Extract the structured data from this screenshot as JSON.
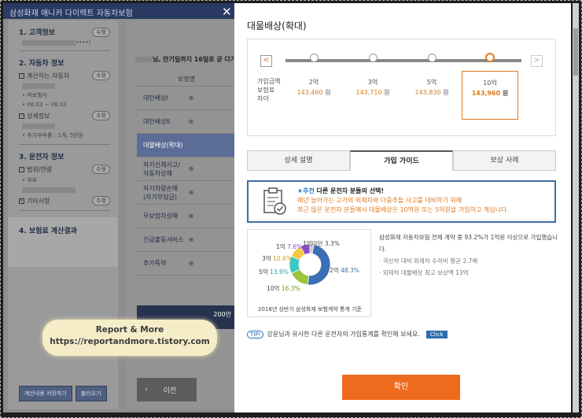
{
  "bg": {
    "title": "삼성화재 애니카 다이렉트 자동차보험",
    "close": "✕",
    "sections": [
      {
        "title": "1. 고객정보",
        "pill": "수정",
        "lines": [
          "••••)"
        ]
      },
      {
        "title": "2. 자동차 정보",
        "sub1": "계산하는 자동차",
        "sub1_pill": "수정",
        "lines1": [
          "• 피보험자",
          "• 08.03 ~ 08.03"
        ],
        "sub2": "상세정보",
        "sub2_pill": "수정",
        "lines2": [
          "• 추가부속품 : 1개, 5만원"
        ]
      },
      {
        "title": "3. 운전자 정보",
        "sub1": "범위/연령",
        "sub1_pill": "수정",
        "lines1": [
          "• 부부"
        ],
        "sub2": "기타사항",
        "sub2_pill": "수정"
      },
      {
        "title": "4. 보험료 계산결과"
      }
    ],
    "buttons": [
      "계산내용 저장하기",
      "불러오기"
    ],
    "headline": "님, 만기일까지 16일로 곧 다가",
    "table_header": "보장명",
    "rows": [
      "대인배상I",
      "대인배상II",
      "대물배상(확대)",
      "자기신체사고/자동차상해",
      "자기차량손해(자기부담금)",
      "무보험차상해",
      "긴급출동서비스",
      "추가특약"
    ],
    "row_plus": "⊕",
    "dark_amount": "200만",
    "prev": "이전",
    "prev_arrow": "‹",
    "watermark_line1": "Report & More",
    "watermark_line2": "https://reportandmore.tistory.com"
  },
  "modal": {
    "title": "대물배상(확대)",
    "slider": {
      "left_arrow": "<",
      "right_arrow": ">",
      "label": [
        "가입금액",
        "보험료",
        "차이"
      ],
      "options": [
        {
          "amount": "2억",
          "price": "143,460",
          "unit": "원"
        },
        {
          "amount": "3억",
          "price": "143,710",
          "unit": "원"
        },
        {
          "amount": "5억",
          "price": "143,830",
          "unit": "원"
        },
        {
          "amount": "10억",
          "price": "143,960",
          "unit": "원"
        }
      ],
      "selected_index": 3
    },
    "tabs": [
      "상세 설명",
      "가입 가이드",
      "보상 사례"
    ],
    "active_tab": 1,
    "guide": {
      "badge": "★추천",
      "headline": "다른 운전자 분들의 선택!",
      "line1": "매년 늘어가는 고가의 외제차와 다중추돌 사고를 대비하기 위해",
      "line2": "최근 많은 운전자 분들께서 대물배상은 10억원 또는 5억원을 가입하고 계십니다."
    },
    "chart_data": {
      "type": "pie",
      "labels": [
        "1억미만",
        "1억",
        "2억",
        "3억",
        "5억",
        "10억"
      ],
      "values": [
        3.3,
        7.6,
        48.3,
        10.6,
        13.9,
        16.3
      ],
      "colors": [
        "#c9c9c9",
        "#8a4fc8",
        "#3a6eb5",
        "#f5c842",
        "#3bc9c1",
        "#9dc43c"
      ],
      "caption": "2018년 상반기 삼성화재 보험계약 통계 기준"
    },
    "stats": {
      "line1": "삼성화재 자동차보험 전체 계약 중 93.2%가 1억원 이상으로 가입했습니다.",
      "line2": "· 국산차 대비 외제차 수리비 평균 2.7배",
      "line3": "· 외제차 대물배상 최고 보상액 13억"
    },
    "tip": {
      "badge": "TIP!",
      "text": "강윤님과 유사한 다른 운전자의 가입통계를 확인해 보세요.",
      "click": "Click"
    },
    "confirm": "확인"
  }
}
